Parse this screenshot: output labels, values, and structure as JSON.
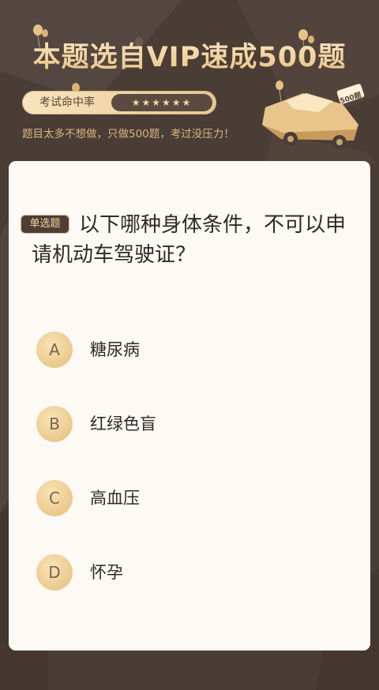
{
  "header": {
    "title": "本题选自VIP速成500题",
    "rate_label": "考试命中率",
    "rate_stars": "★★★★★★",
    "tagline": "题目太多不想做，只做500题，考过没压力！",
    "car_badge": "500题"
  },
  "question": {
    "type_badge": "单选题",
    "text": "以下哪种身体条件，不可以申请机动车驾驶证？"
  },
  "options": [
    {
      "letter": "A",
      "text": "糖尿病"
    },
    {
      "letter": "B",
      "text": "红绿色盲"
    },
    {
      "letter": "C",
      "text": "高血压"
    },
    {
      "letter": "D",
      "text": "怀孕"
    }
  ],
  "colors": {
    "background": "#4a3d36",
    "card": "#fdfaf5",
    "gold": "#e9c587",
    "text": "#2e2a28"
  }
}
